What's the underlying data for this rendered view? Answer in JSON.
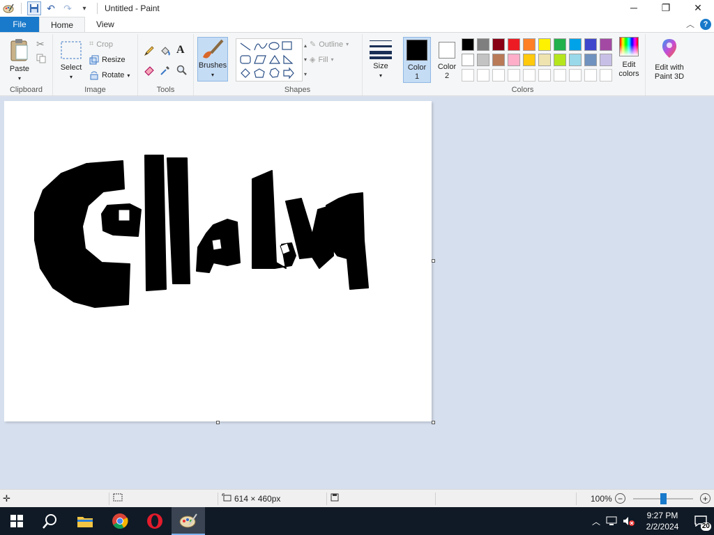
{
  "window": {
    "title": "Untitled - Paint"
  },
  "quick_access": {
    "icons": [
      "paint-app-icon",
      "save-icon",
      "undo-icon",
      "redo-icon",
      "customize-icon"
    ]
  },
  "window_controls": {
    "minimize": "─",
    "maximize": "❐",
    "close": "✕"
  },
  "tabs": [
    {
      "label": "File"
    },
    {
      "label": "Home"
    },
    {
      "label": "View"
    }
  ],
  "ribbon": {
    "clipboard": {
      "label": "Clipboard",
      "paste": "Paste"
    },
    "image": {
      "label": "Image",
      "select": "Select",
      "crop": "Crop",
      "resize": "Resize",
      "rotate": "Rotate"
    },
    "tools": {
      "label": "Tools"
    },
    "brushes": {
      "label": "Brushes"
    },
    "shapes": {
      "label": "Shapes",
      "outline": "Outline",
      "fill": "Fill"
    },
    "size": {
      "label": "Size"
    },
    "colors": {
      "label": "Colors",
      "color1": "Color",
      "color1_num": "1",
      "color2": "Color",
      "color2_num": "2",
      "edit_colors_1": "Edit",
      "edit_colors_2": "colors",
      "paint3d_1": "Edit with",
      "paint3d_2": "Paint 3D",
      "color1_value": "#000000",
      "color2_value": "#ffffff",
      "row1": [
        "#000000",
        "#7f7f7f",
        "#880015",
        "#ed1c24",
        "#ff7f27",
        "#fff200",
        "#22b14c",
        "#00a2e8",
        "#3f48cc",
        "#a349a4"
      ],
      "row2": [
        "#ffffff",
        "#c3c3c3",
        "#b97a57",
        "#ffaec9",
        "#ffc90e",
        "#efe4b0",
        "#b5e61d",
        "#99d9ea",
        "#7092be",
        "#c8bfe7"
      ]
    }
  },
  "status": {
    "image_size": "614 × 460px",
    "zoom": "100%",
    "zoom_level": 0.5
  },
  "taskbar": {
    "time": "9:27 PM",
    "date": "2/2/2024",
    "notifications": "20"
  }
}
